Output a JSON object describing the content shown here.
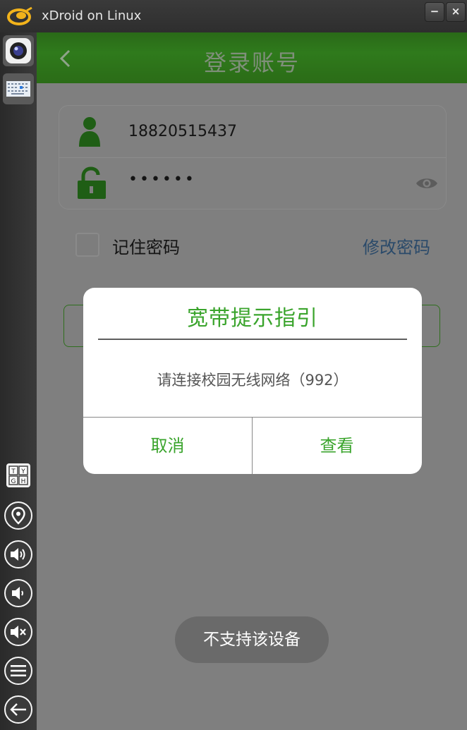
{
  "window": {
    "title": "xDroid on Linux",
    "minimize_label": "−",
    "close_label": "×"
  },
  "sidebar": {
    "top_icons": [
      "camera-icon",
      "keyboard-layout-icon"
    ],
    "bottom_icons": [
      "keymap-icon",
      "location-icon",
      "volume-up-icon",
      "volume-down-icon",
      "mute-icon",
      "menu-icon",
      "back-icon"
    ],
    "keymap_keys": [
      "T",
      "Y",
      "G",
      "H"
    ]
  },
  "app": {
    "title": "登录账号",
    "phone": "18820515437",
    "password_mask": "••••••",
    "remember_label": "记住密码",
    "change_password_label": "修改密码",
    "accent": "#3aa42c"
  },
  "dialog": {
    "title": "宽带提示指引",
    "message": "请连接校园无线网络（992）",
    "cancel_label": "取消",
    "view_label": "查看"
  },
  "toast": {
    "text": "不支持该设备"
  }
}
